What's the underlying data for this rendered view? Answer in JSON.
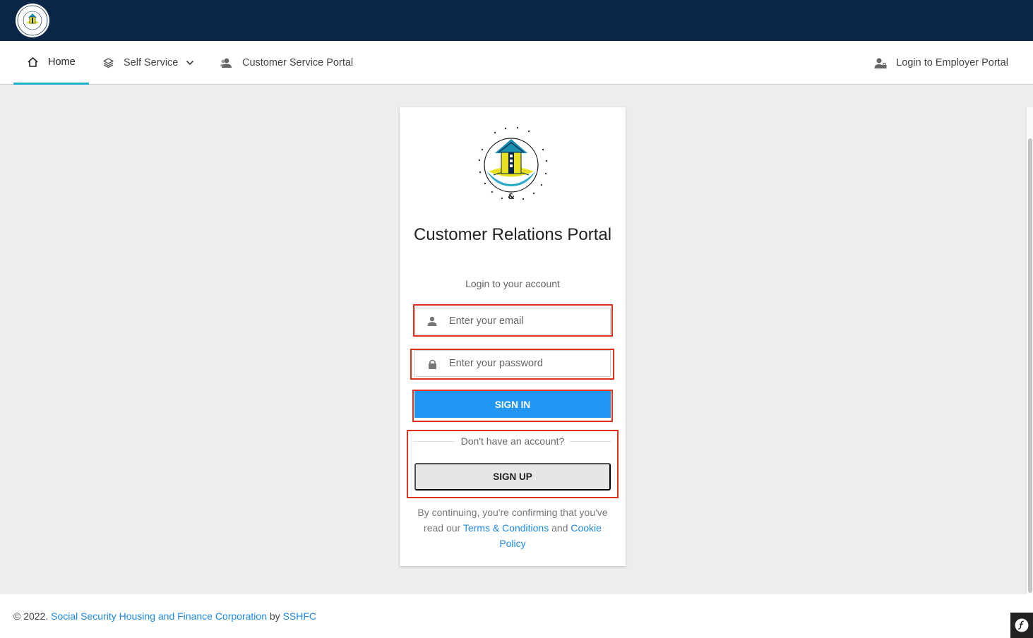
{
  "header": {
    "logo_icon": "sshfc-logo-icon"
  },
  "nav": {
    "home_label": "Home",
    "self_service_label": "Self Service",
    "customer_service_label": "Customer Service Portal",
    "employer_login_label": "Login to Employer Portal"
  },
  "card": {
    "title": "Customer Relations Portal",
    "subtitle": "Login to your account",
    "email_placeholder": "Enter your email",
    "password_placeholder": "Enter your password",
    "signin_label": "SIGN IN",
    "no_account_text": "Don't have an account?",
    "signup_label": "SIGN UP",
    "terms_prefix": "By continuing, you're confirming that you've read our",
    "terms_link": "Terms & Conditions",
    "terms_and": "and",
    "cookie_link": "Cookie Policy"
  },
  "footer": {
    "copyright": "© 2022.",
    "org_link": "Social Security Housing and Finance Corporation",
    "by_text": "by",
    "brand_link": "SSHFC"
  },
  "colors": {
    "topbar": "#0a2647",
    "accent": "#21b0c9",
    "primary_button": "#2196f3",
    "link": "#1e88e5",
    "highlight_box": "#e0301e"
  }
}
